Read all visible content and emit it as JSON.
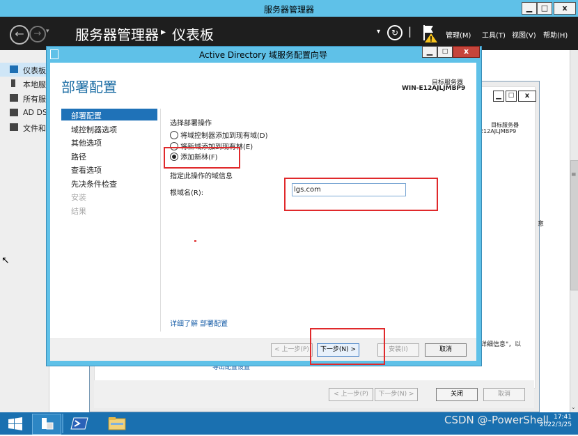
{
  "server_manager": {
    "title": "服务器管理器",
    "breadcrumb_root": "服务器管理器",
    "breadcrumb_separator": "▸",
    "breadcrumb_current": "仪表板",
    "menus": [
      "管理(M)",
      "工具(T)",
      "视图(V)",
      "帮助(H)"
    ],
    "window_buttons": {
      "min": "▁",
      "max": "□",
      "close": "x"
    }
  },
  "sidebar": {
    "items": [
      {
        "label": "仪表板"
      },
      {
        "label": "本地服务器"
      },
      {
        "label": "所有服务器"
      },
      {
        "label": "AD DS"
      },
      {
        "label": "文件和存储服务"
      }
    ]
  },
  "background_dialog": {
    "target_label": "目标服务器",
    "target_server": "E12AJLJMBP9",
    "partial_text": "意",
    "detail_text": "详细信息\"，以",
    "export_link": "导出配置设置",
    "buttons": [
      "< 上一步(P)",
      "下一步(N) >",
      "关闭",
      "取消"
    ]
  },
  "wizard": {
    "title": "Active Directory 域服务配置向导",
    "page_title": "部署配置",
    "target_label": "目标服务器",
    "target_server": "WIN-E12AJLJMBP9",
    "steps": [
      {
        "label": "部署配置",
        "state": "active"
      },
      {
        "label": "域控制器选项",
        "state": "enabled"
      },
      {
        "label": "其他选项",
        "state": "enabled"
      },
      {
        "label": "路径",
        "state": "enabled"
      },
      {
        "label": "查看选项",
        "state": "enabled"
      },
      {
        "label": "先决条件检查",
        "state": "enabled"
      },
      {
        "label": "安装",
        "state": "disabled"
      },
      {
        "label": "结果",
        "state": "disabled"
      }
    ],
    "select_operation_label": "选择部署操作",
    "operations": [
      {
        "label": "将域控制器添加到现有域(D)",
        "selected": false
      },
      {
        "label": "将新域添加到现有林(E)",
        "selected": false
      },
      {
        "label": "添加新林(F)",
        "selected": true
      }
    ],
    "domain_info_label": "指定此操作的域信息",
    "root_domain_label": "根域名(R):",
    "root_domain_value": "lgs.com",
    "more_info_link": "详细了解 部署配置",
    "buttons": {
      "prev": "< 上一步(P)",
      "next": "下一步(N) >",
      "install": "安装(I)",
      "cancel": "取消"
    }
  },
  "taskbar": {
    "clock_time": "17:41",
    "clock_date": "2022/3/25",
    "watermark": "CSDN @-PowerShell"
  },
  "colors": {
    "title_bar": "#5fc1e8",
    "header_bg": "#1e1e1e",
    "accent": "#1f72b8",
    "highlight_box": "#e0292b",
    "taskbar": "#1a70b0"
  }
}
